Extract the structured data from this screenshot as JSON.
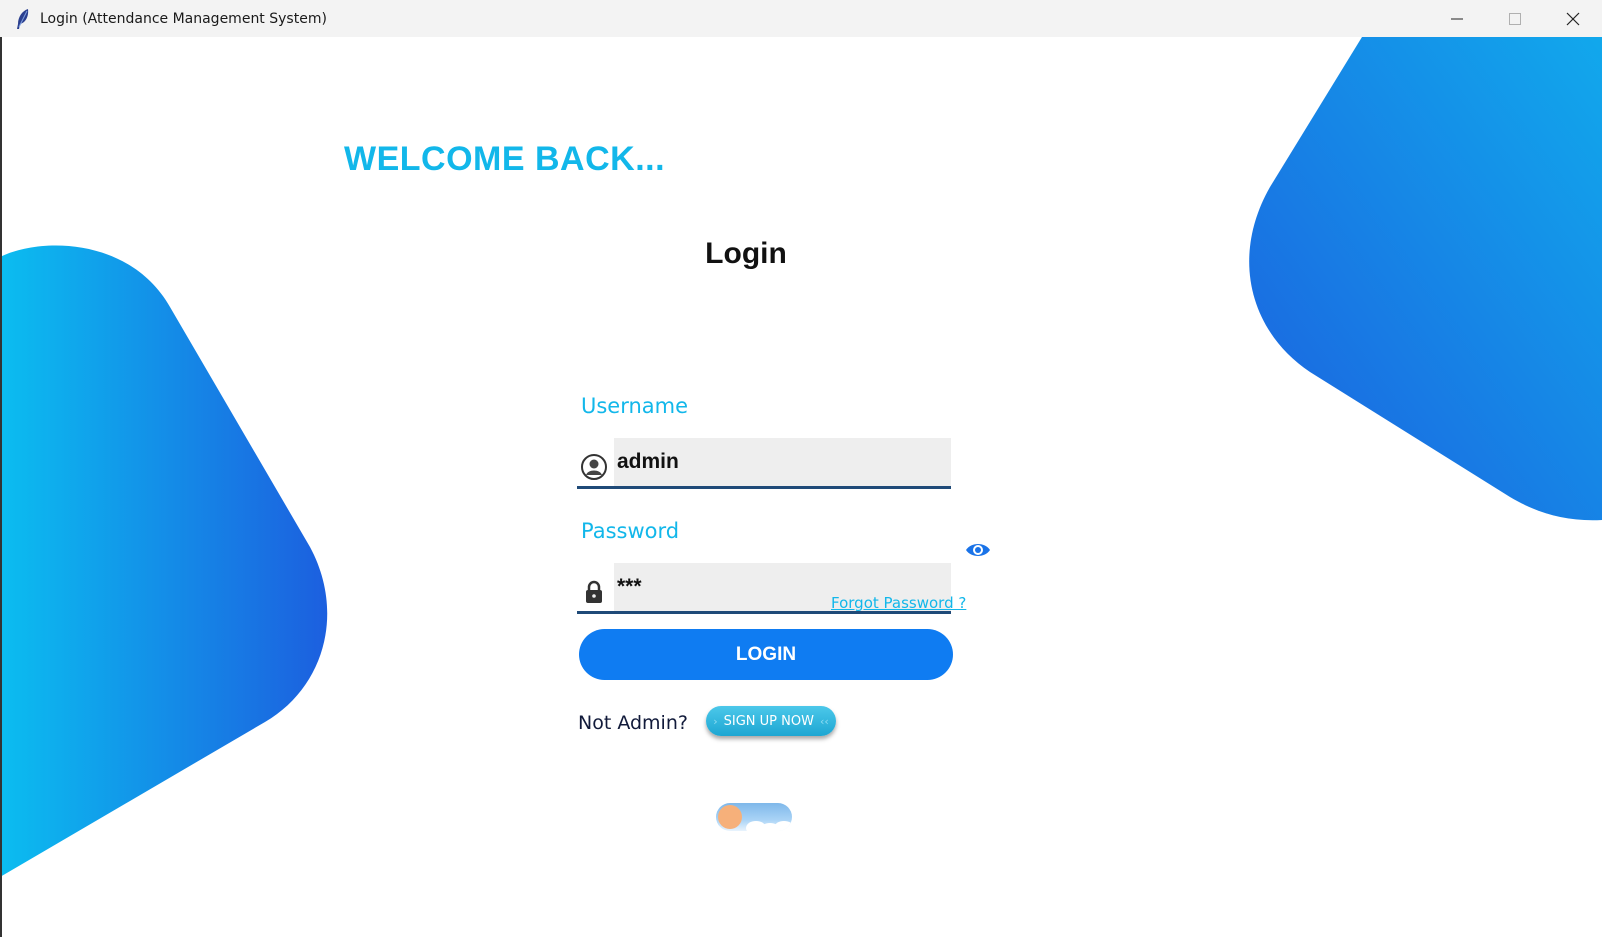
{
  "window": {
    "title": "Login (Attendance Management System)",
    "app_icon": "feather-icon",
    "controls": [
      "minimize-icon",
      "maximize-icon",
      "close-icon"
    ]
  },
  "welcome": "WELCOME BACK...",
  "heading": "Login",
  "username": {
    "label": "Username",
    "value": "admin",
    "icon": "user-icon"
  },
  "password": {
    "label": "Password",
    "value": "***",
    "icon": "lock-icon",
    "toggle_icon": "eye-icon"
  },
  "forgot_password": "Forgot Password ?",
  "login_button": "LOGIN",
  "not_admin": "Not Admin?",
  "signup_button": "SIGN UP NOW",
  "theme_toggle": {
    "state": "off",
    "icon": "sun-knob"
  },
  "colors": {
    "accent": "#12b7ea",
    "primary": "#0f7cf2",
    "shape_gradient_start": "#0bbdf0",
    "shape_gradient_end": "#1c5fdf"
  }
}
